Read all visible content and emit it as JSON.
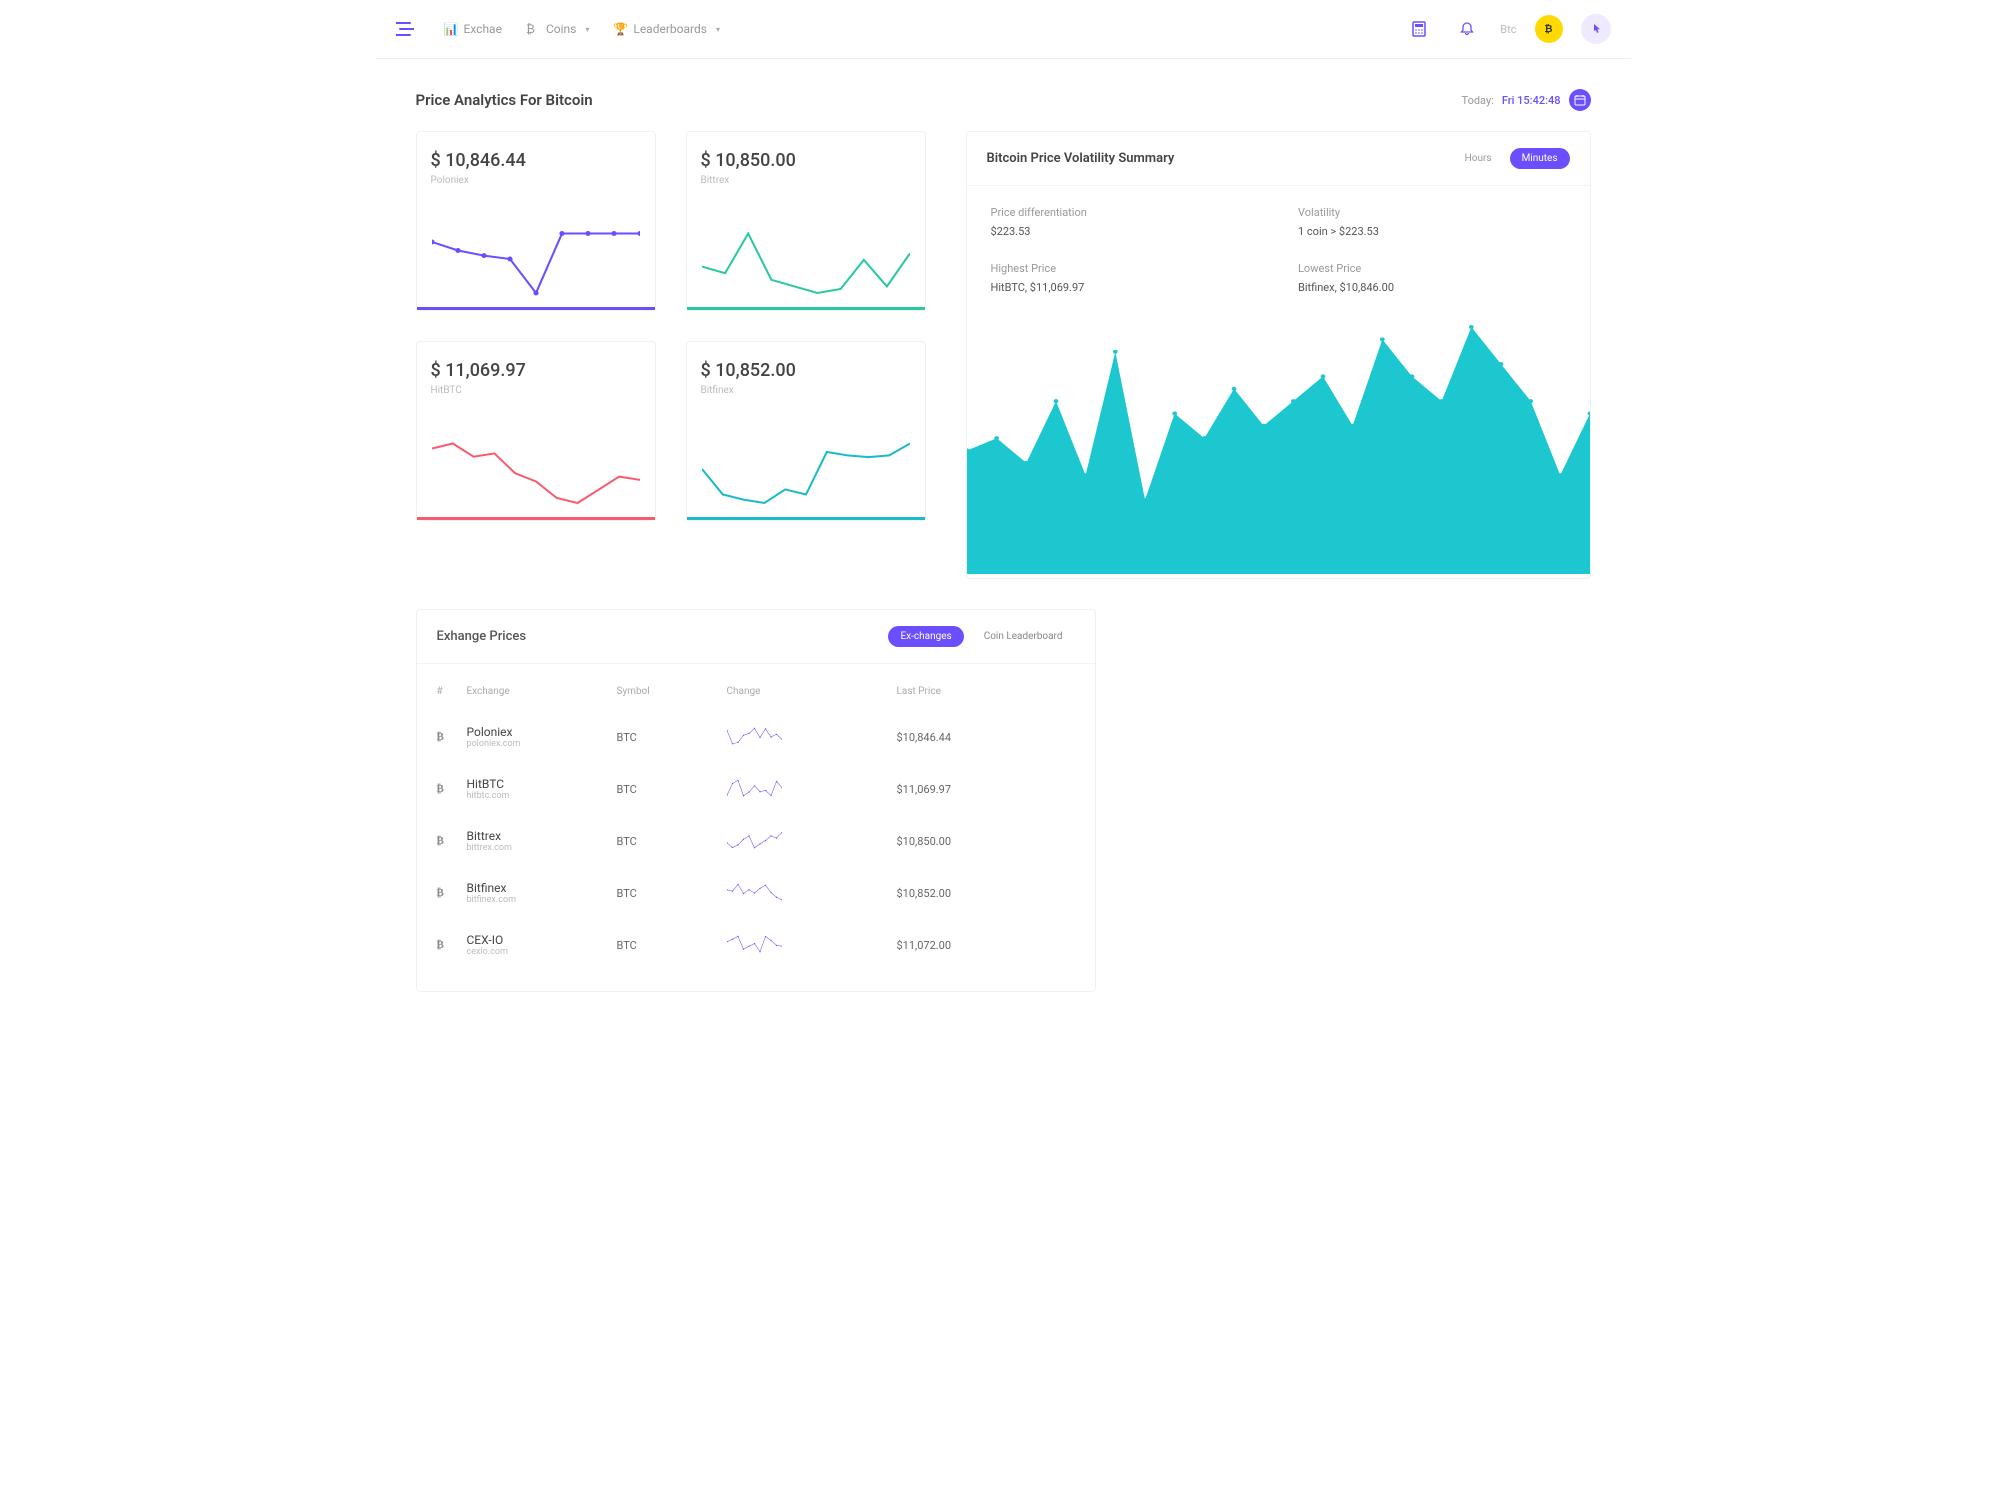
{
  "nav": {
    "exchange": "Exchae",
    "coins": "Coins",
    "leaderboards": "Leaderboards",
    "btc": "Btc"
  },
  "header": {
    "title": "Price Analytics For Bitcoin",
    "today": "Today:",
    "date": "Fri 15:42:48"
  },
  "cards": [
    {
      "price": "$ 10,846.44",
      "exchange": "Poloniex",
      "color": "#6b4fff"
    },
    {
      "price": "$ 10,850.00",
      "exchange": "Bittrex",
      "color": "#2bc8a3"
    },
    {
      "price": "$ 11,069.97",
      "exchange": "HitBTC",
      "color": "#f75b6f"
    },
    {
      "price": "$ 10,852.00",
      "exchange": "Bitfinex",
      "color": "#1cb9c8"
    }
  ],
  "vol": {
    "title": "Bitcoin Price Volatility Summary",
    "hours": "Hours",
    "minutes": "Minutes",
    "stats": {
      "diff_l": "Price differentiation",
      "diff_v": "$223.53",
      "volat_l": "Volatility",
      "volat_v": "1 coin > $223.53",
      "hi_l": "Highest Price",
      "hi_v": "HitBTC, $11,069.97",
      "lo_l": "Lowest Price",
      "lo_v": "Bitfinex, $10,846.00"
    }
  },
  "ex": {
    "title": "Exhange Prices",
    "tab1": "Ex-changes",
    "tab2": "Coin Leaderboard",
    "cols": {
      "n": "#",
      "ex": "Exchange",
      "sym": "Symbol",
      "chg": "Change",
      "last": "Last Price"
    },
    "rows": [
      {
        "name": "Poloniex",
        "site": "poloniex.com",
        "sym": "BTC",
        "last": "$10,846.44"
      },
      {
        "name": "HitBTC",
        "site": "hitbtc.com",
        "sym": "BTC",
        "last": "$11,069.97"
      },
      {
        "name": "Bittrex",
        "site": "bittrex.com",
        "sym": "BTC",
        "last": "$10,850.00"
      },
      {
        "name": "Bitfinex",
        "site": "bitfinex.com",
        "sym": "BTC",
        "last": "$10,852.00"
      },
      {
        "name": "CEX-IO",
        "site": "cexio.com",
        "sym": "BTC",
        "last": "$11,072.00"
      }
    ]
  },
  "chart_data": {
    "mini_sparks": [
      {
        "type": "line",
        "color": "#6b4fff",
        "values": [
          50,
          45,
          42,
          40,
          20,
          55,
          55,
          55,
          55
        ]
      },
      {
        "type": "line",
        "color": "#2bc8a3",
        "values": [
          35,
          30,
          60,
          25,
          20,
          15,
          18,
          40,
          20,
          45
        ]
      },
      {
        "type": "line",
        "color": "#f75b6f",
        "values": [
          55,
          58,
          50,
          52,
          40,
          35,
          25,
          22,
          30,
          38,
          36
        ]
      },
      {
        "type": "line",
        "color": "#1cb9c8",
        "values": [
          40,
          25,
          22,
          20,
          28,
          25,
          50,
          48,
          47,
          48,
          55
        ]
      }
    ],
    "area": {
      "type": "area",
      "color": "#1cc7d0",
      "values": [
        50,
        55,
        45,
        70,
        40,
        90,
        30,
        65,
        55,
        75,
        60,
        70,
        80,
        60,
        95,
        80,
        70,
        100,
        85,
        70,
        40,
        65
      ]
    }
  }
}
